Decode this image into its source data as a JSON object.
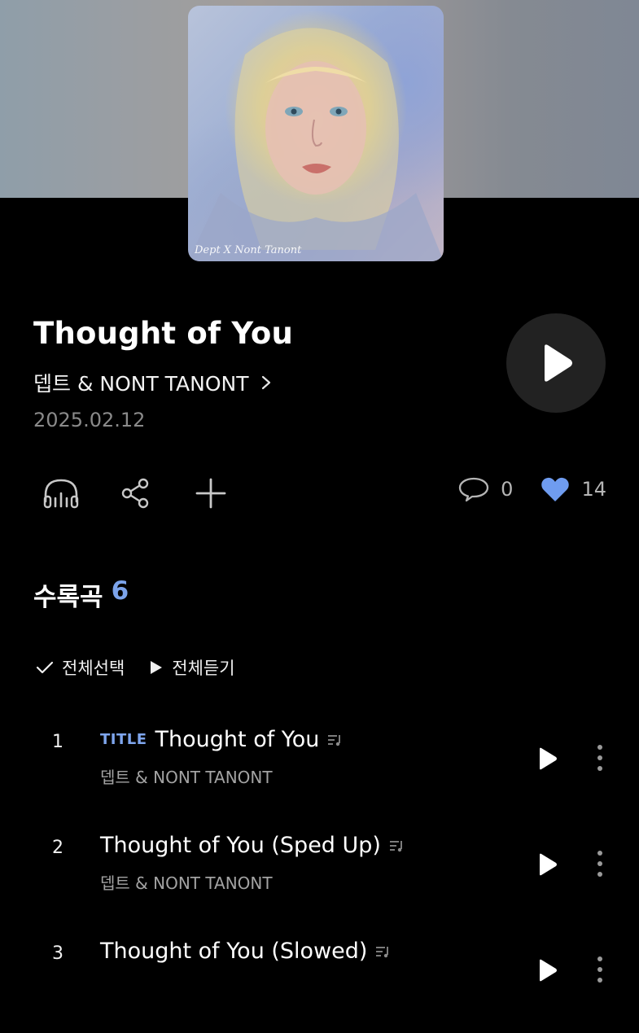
{
  "album": {
    "cover_signature": "Dept X Nont Tanont",
    "title": "Thought of You",
    "artist": "뎁트 & NONT TANONT",
    "date": "2025.02.12"
  },
  "actions": {
    "comments_count": "0",
    "likes_count": "14",
    "like_color": "#6f9cf0"
  },
  "tracklist": {
    "heading": "수록곡",
    "count": "6",
    "select_all": "전체선택",
    "play_all": "전체듣기"
  },
  "tracks": [
    {
      "num": "1",
      "badge": "TITLE",
      "title": "Thought of You",
      "artist": "뎁트 & NONT TANONT"
    },
    {
      "num": "2",
      "badge": "",
      "title": "Thought of You (Sped Up)",
      "artist": "뎁트 & NONT TANONT"
    },
    {
      "num": "3",
      "badge": "",
      "title": "Thought of You (Slowed)",
      "artist": ""
    }
  ]
}
